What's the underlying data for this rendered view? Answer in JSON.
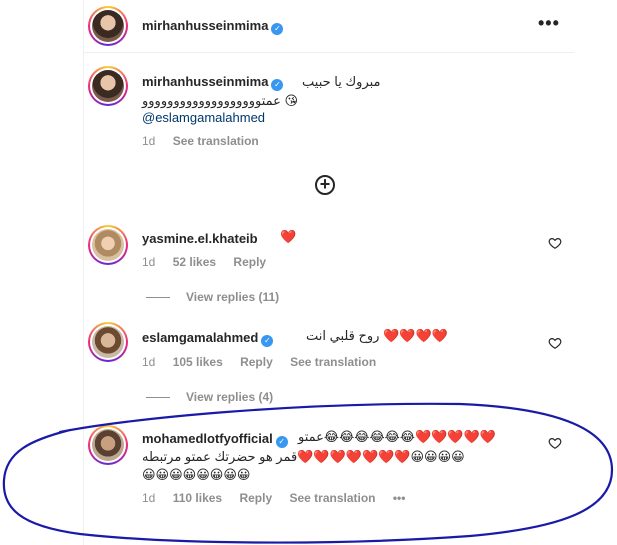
{
  "header": {
    "username": "mirhanhusseinmima",
    "more_label": "•••"
  },
  "caption": {
    "username": "mirhanhusseinmima",
    "line1": "مبروك يا حبيب",
    "line2": "عمتووووووووووووووووووو 😘",
    "mention": "@eslamgamalahmed",
    "time": "1d",
    "see_translation": "See translation"
  },
  "load_more": "+",
  "comments": [
    {
      "username": "yasmine.el.khateib",
      "text": "❤️",
      "time": "1d",
      "likes": "52 likes",
      "reply": "Reply",
      "view_replies": "View replies (11)"
    },
    {
      "username": "eslamgamalahmed",
      "text": "روح قلبي انت ❤️❤️❤️❤️",
      "time": "1d",
      "likes": "105 likes",
      "reply": "Reply",
      "see_translation": "See translation",
      "view_replies": "View replies (4)"
    },
    {
      "username": "mohamedlotfyofficial",
      "line1": "عمتو😂😂😂😂😂😂❤️❤️❤️❤️❤️",
      "line2": "قمر هو حضرتك عمتو مرتبطه❤️❤️❤️❤️❤️❤️❤️😀😀😀😀",
      "line3": "😀😀😀😀😀😀😀😀",
      "time": "1d",
      "likes": "110 likes",
      "reply": "Reply",
      "see_translation": "See translation",
      "more": "•••"
    }
  ],
  "colors": {
    "verified": "#3897f0",
    "annotation": "#1a1aa8",
    "meta": "#8e8e8e"
  }
}
